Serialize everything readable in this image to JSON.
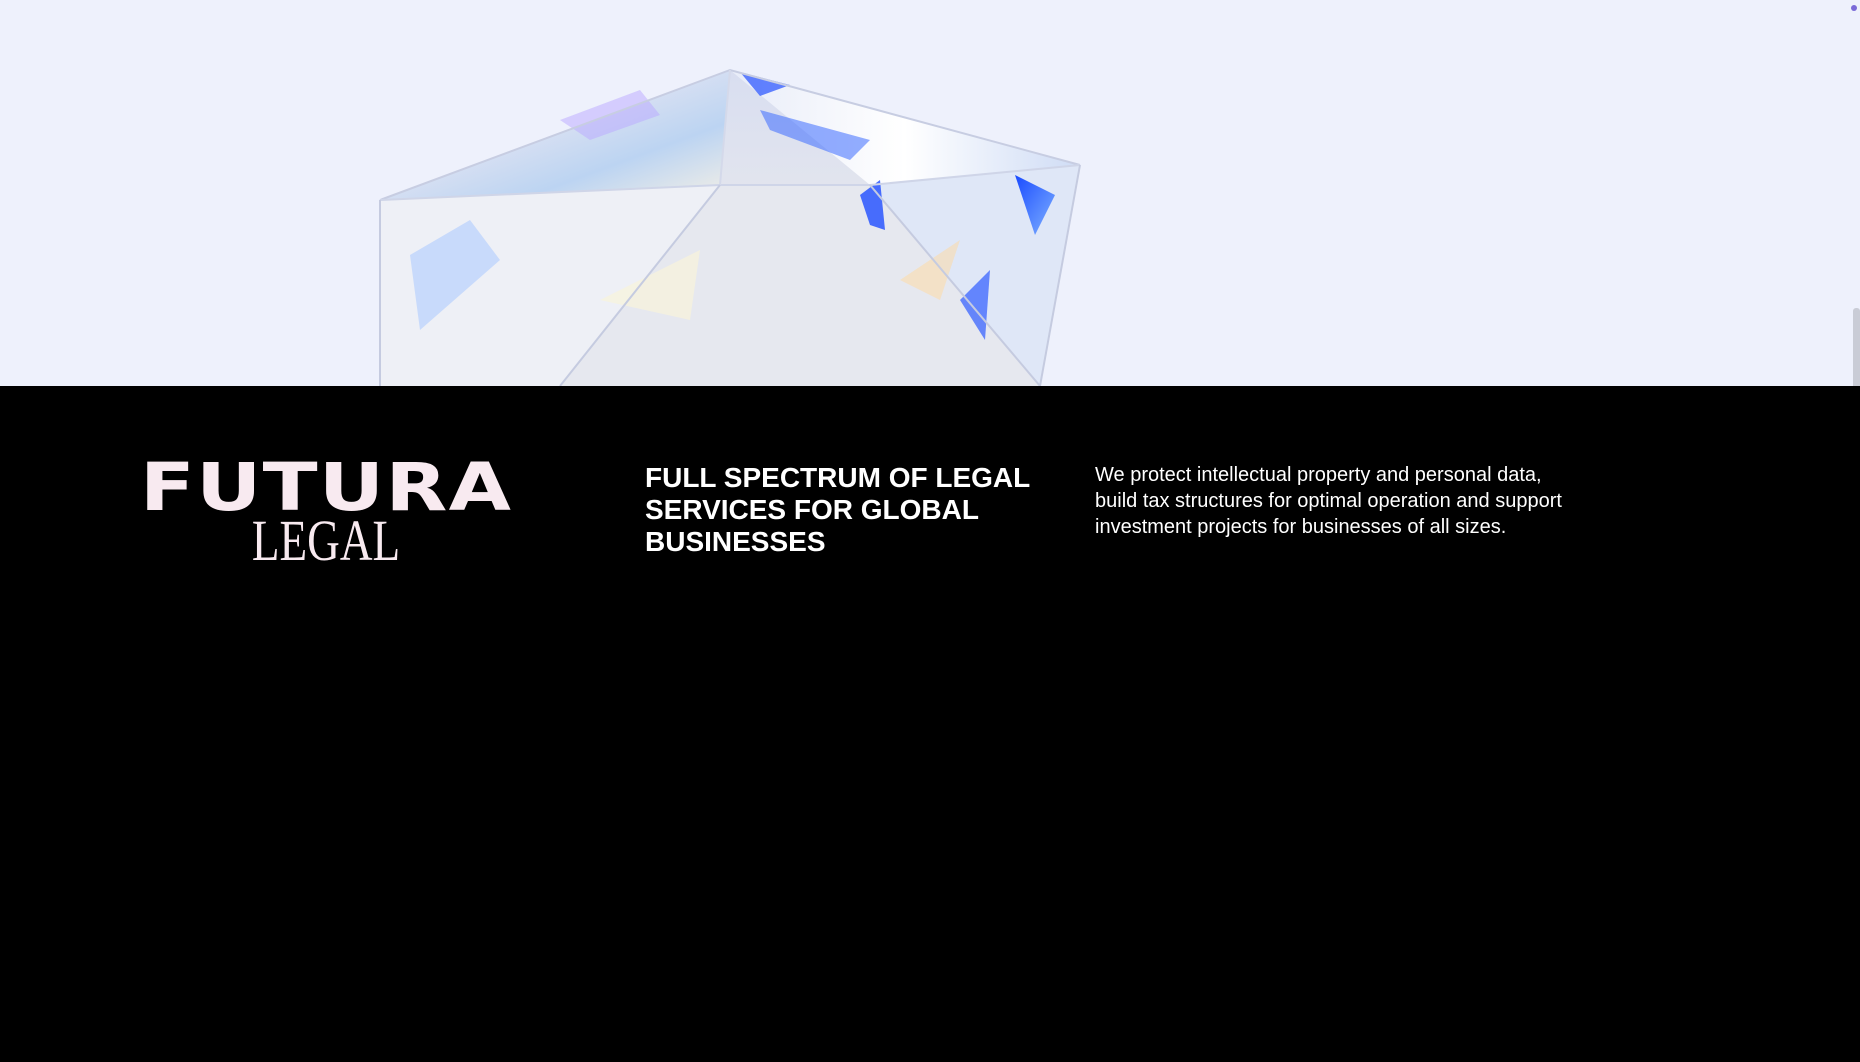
{
  "hero": {
    "image": "crystal-gem-illustration",
    "background_color": "#eef1fc"
  },
  "brand": {
    "logo_main": "FUTURA",
    "logo_sub": "LEGAL",
    "logo_color": "#f8eaf0"
  },
  "intro": {
    "headline": "FULL SPECTRUM OF LEGAL SERVICES FOR GLOBAL BUSINESSES",
    "description": "We protect intellectual property and personal data, build tax structures for optimal operation and support investment projects for businesses of all sizes."
  }
}
